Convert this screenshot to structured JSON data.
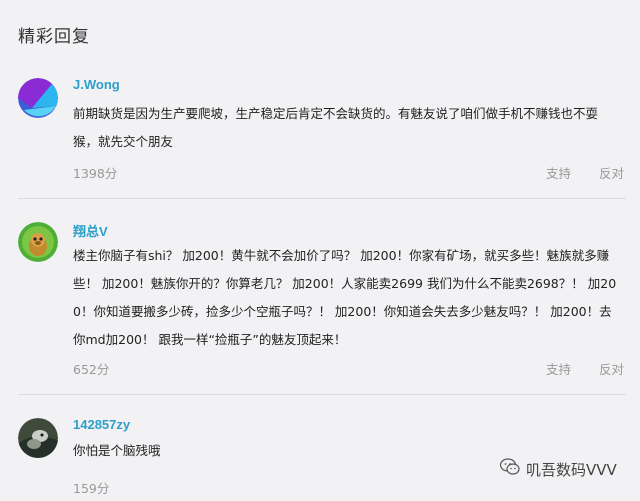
{
  "section": {
    "title": "精彩回复"
  },
  "comments": [
    {
      "username": "J.Wong",
      "lines": [
        "前期缺货是因为生产要爬坡，生产稳定后肯定不会缺货的。有魅友说了咱们做手机不赚钱也不耍",
        "猴，就先交个朋友"
      ],
      "score": "1398分",
      "support": "支持",
      "oppose": "反对"
    },
    {
      "username": "翔总V",
      "lines": [
        "楼主你脑子有shi？ 加200！黄牛就不会加价了吗？ 加200！你家有矿场，就买多些！魅族就多赚",
        "些！ 加200！魅族你开的？你算老几？ 加200！人家能卖2699 我们为什么不能卖2698？！ 加20",
        "0！你知道要搬多少砖，捡多少个空瓶子吗？！ 加200！你知道会失去多少魅友吗？！ 加200！去",
        "你md加200！ 跟我一样“捡瓶子”的魅友顶起来！"
      ],
      "score": "652分",
      "support": "支持",
      "oppose": "反对"
    },
    {
      "username": "142857zy",
      "lines": [
        "你怕是个脑残哦"
      ],
      "score": "159分",
      "support": "支持",
      "oppose": "反对"
    }
  ],
  "watermark": {
    "text": "叽吾数码VVV"
  }
}
